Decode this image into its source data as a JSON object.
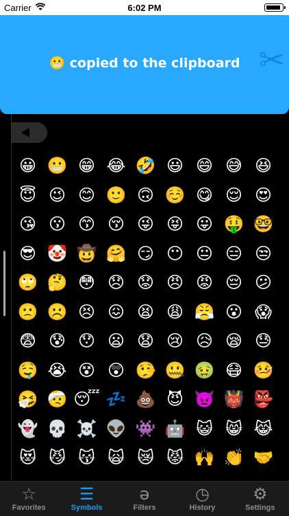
{
  "status_bar": {
    "carrier": "Carrier",
    "time": "6:02 PM",
    "battery_level": 0.92
  },
  "toast": {
    "emoji": "😬",
    "message": "copied to the clipboard",
    "icon": "scissors-icon"
  },
  "emojis": [
    "😀",
    "😬",
    "😁",
    "😂",
    "🤣",
    "😃",
    "😄",
    "😅",
    "😆",
    "😇",
    "😉",
    "😊",
    "🙂",
    "🙃",
    "☺️",
    "😋",
    "😌",
    "😍",
    "😘",
    "😗",
    "😙",
    "😚",
    "😜",
    "😝",
    "😛",
    "🤑",
    "🤓",
    "😎",
    "🤡",
    "🤠",
    "🤗",
    "😏",
    "😶",
    "😐",
    "😑",
    "😒",
    "🙄",
    "🤔",
    "😳",
    "😞",
    "😟",
    "😠",
    "😡",
    "😔",
    "😕",
    "🙁",
    "☹️",
    "😣",
    "😖",
    "😫",
    "😩",
    "😤",
    "😮",
    "😱",
    "😨",
    "😰",
    "😯",
    "😦",
    "😧",
    "😢",
    "😥",
    "😪",
    "😓",
    "🤤",
    "😭",
    "😵",
    "😲",
    "🤥",
    "🤐",
    "🤢",
    "😷",
    "🤒",
    "🤧",
    "🤕",
    "😴",
    "💤",
    "💩",
    "😈",
    "👿",
    "👹",
    "👺",
    "👻",
    "💀",
    "☠️",
    "👽",
    "👾",
    "🤖",
    "😺",
    "😸",
    "😹",
    "😻",
    "😼",
    "😽",
    "🙀",
    "😿",
    "😾",
    "🙌",
    "👏",
    "🤝"
  ],
  "tabs": [
    {
      "label": "Favorites",
      "icon": "☆",
      "active": false
    },
    {
      "label": "Symbols",
      "icon": "☰",
      "active": true
    },
    {
      "label": "Filters",
      "icon": "ə",
      "active": false
    },
    {
      "label": "History",
      "icon": "◷",
      "active": false
    },
    {
      "label": "Settings",
      "icon": "⚙",
      "active": false
    }
  ],
  "colors": {
    "toast_background": "#29a8ff",
    "active_tab": "#1f9bf0",
    "inactive_tab": "#8e8e8e"
  }
}
